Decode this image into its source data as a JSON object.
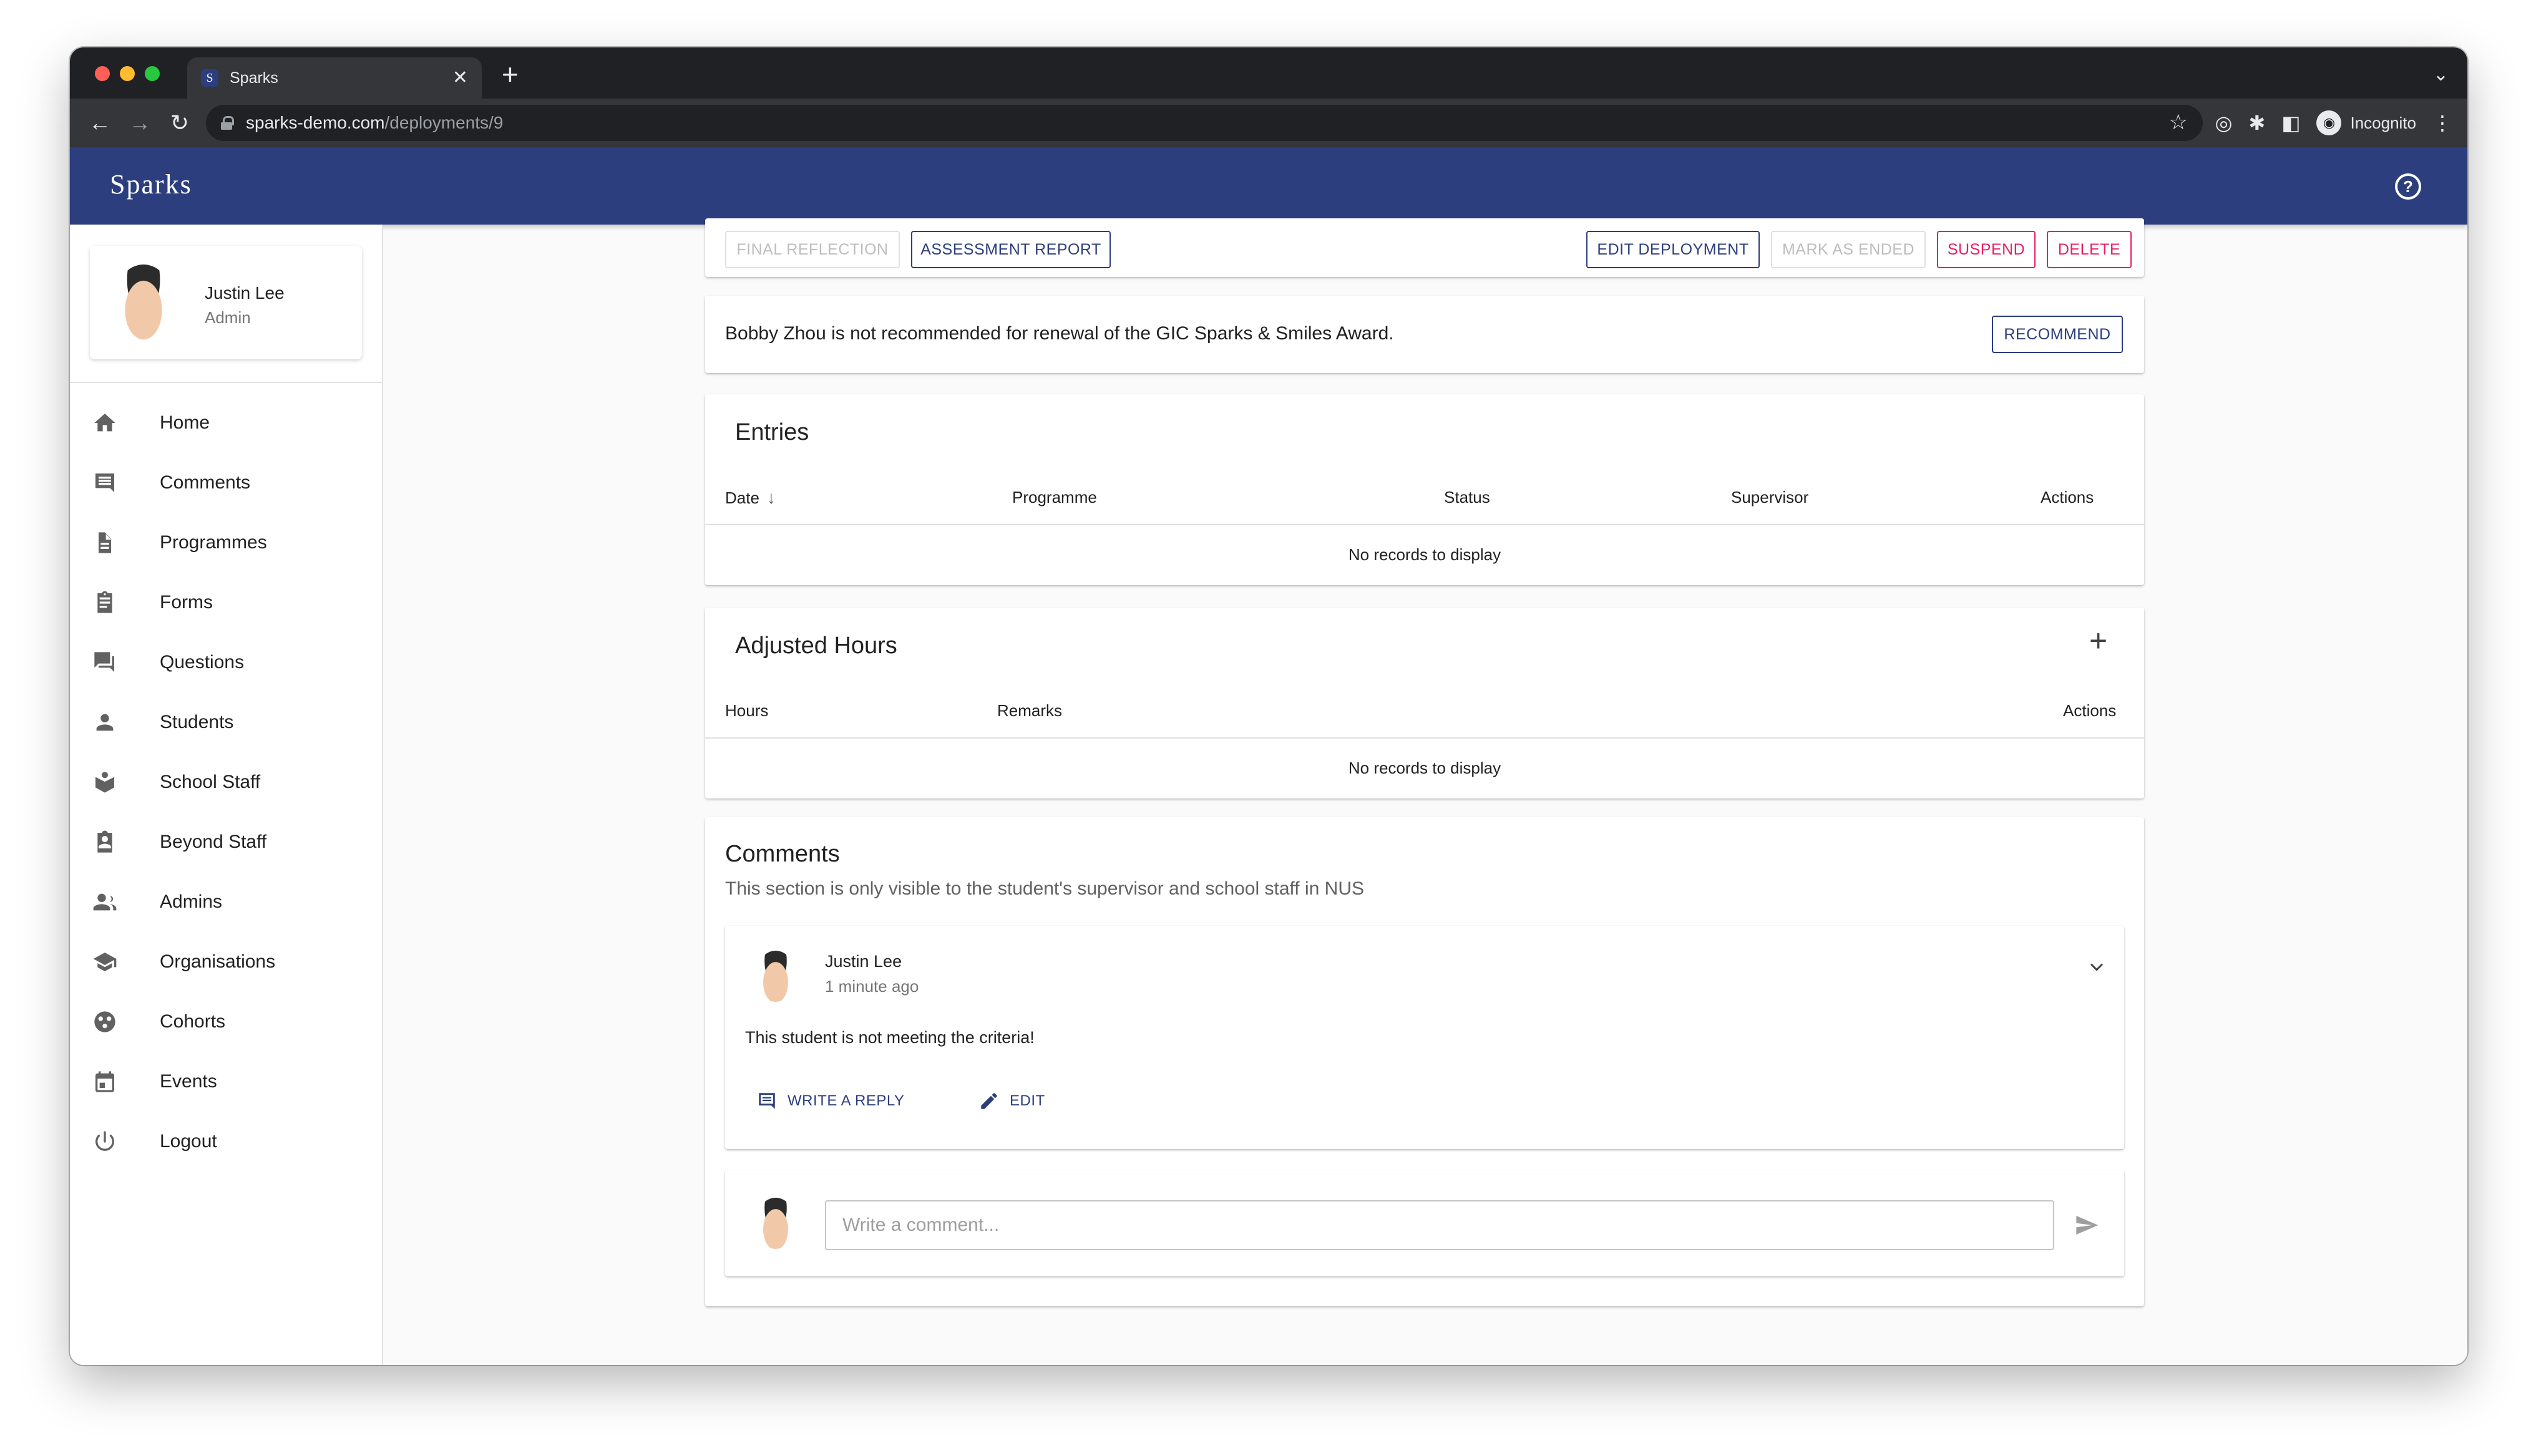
{
  "browser": {
    "tab_title": "Sparks",
    "tab_favicon_letter": "S",
    "url_host": "sparks-demo.com",
    "url_path": "/deployments/9",
    "profile_label": "Incognito"
  },
  "app": {
    "brand": "Sparks",
    "accent_color": "#2c3e7e",
    "danger_color": "#e91e63"
  },
  "sidebar": {
    "user_name": "Justin Lee",
    "user_role": "Admin",
    "items": [
      {
        "label": "Home",
        "icon": "home-icon"
      },
      {
        "label": "Comments",
        "icon": "comment-icon"
      },
      {
        "label": "Programmes",
        "icon": "document-icon"
      },
      {
        "label": "Forms",
        "icon": "clipboard-icon"
      },
      {
        "label": "Questions",
        "icon": "forum-icon"
      },
      {
        "label": "Students",
        "icon": "person-icon"
      },
      {
        "label": "School Staff",
        "icon": "school-staff-icon"
      },
      {
        "label": "Beyond Staff",
        "icon": "badge-icon"
      },
      {
        "label": "Admins",
        "icon": "group-icon"
      },
      {
        "label": "Organisations",
        "icon": "school-icon"
      },
      {
        "label": "Cohorts",
        "icon": "cohorts-icon"
      },
      {
        "label": "Events",
        "icon": "calendar-icon"
      },
      {
        "label": "Logout",
        "icon": "power-icon"
      }
    ]
  },
  "actions": {
    "final_reflection": "Final Reflection",
    "assessment_report": "Assessment Report",
    "edit_deployment": "Edit Deployment",
    "mark_as_ended": "Mark as ended",
    "suspend": "Suspend",
    "delete": "Delete"
  },
  "recommendation": {
    "text": "Bobby Zhou is not recommended for renewal of the GIC Sparks & Smiles Award.",
    "button": "Recommend"
  },
  "entries": {
    "title": "Entries",
    "columns": [
      "Date",
      "Programme",
      "Status",
      "Supervisor",
      "Actions"
    ],
    "empty": "No records to display"
  },
  "adjusted_hours": {
    "title": "Adjusted Hours",
    "columns": [
      "Hours",
      "Remarks",
      "Actions"
    ],
    "empty": "No records to display"
  },
  "comments": {
    "title": "Comments",
    "subtitle": "This section is only visible to the student's supervisor and school staff in NUS",
    "items": [
      {
        "author": "Justin Lee",
        "time": "1 minute ago",
        "body": "This student is not meeting the criteria!",
        "reply_label": "Write a reply",
        "edit_label": "Edit"
      }
    ],
    "input_placeholder": "Write a comment..."
  }
}
